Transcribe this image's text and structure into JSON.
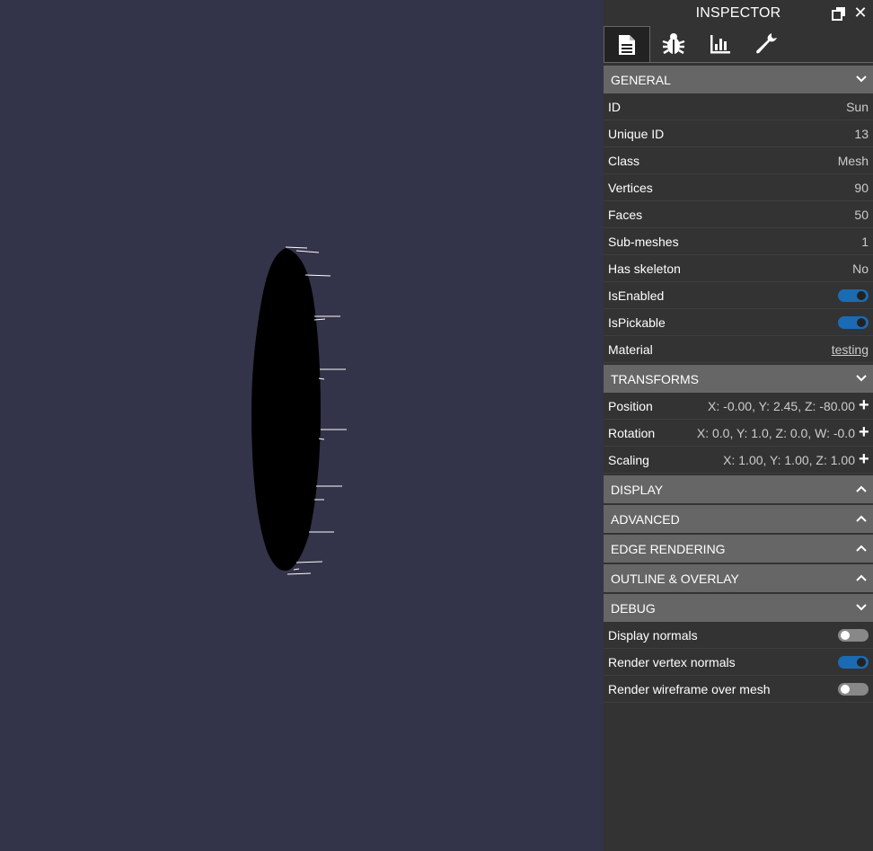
{
  "inspector": {
    "title": "INSPECTOR",
    "tabs": [
      "properties-icon",
      "debug-icon",
      "statistics-icon",
      "tools-icon"
    ],
    "sections": {
      "general": {
        "label": "GENERAL",
        "rows": {
          "id": {
            "label": "ID",
            "value": "Sun"
          },
          "unique_id": {
            "label": "Unique ID",
            "value": "13"
          },
          "class": {
            "label": "Class",
            "value": "Mesh"
          },
          "vertices": {
            "label": "Vertices",
            "value": "90"
          },
          "faces": {
            "label": "Faces",
            "value": "50"
          },
          "submeshes": {
            "label": "Sub-meshes",
            "value": "1"
          },
          "has_skeleton": {
            "label": "Has skeleton",
            "value": "No"
          },
          "is_enabled": {
            "label": "IsEnabled",
            "on": true
          },
          "is_pickable": {
            "label": "IsPickable",
            "on": true
          },
          "material": {
            "label": "Material",
            "value": "testing"
          }
        }
      },
      "transforms": {
        "label": "TRANSFORMS",
        "rows": {
          "position": {
            "label": "Position",
            "value": "X: -0.00, Y: 2.45, Z: -80.00"
          },
          "rotation": {
            "label": "Rotation",
            "value": "X: 0.0, Y: 1.0, Z: 0.0, W: -0.0"
          },
          "scaling": {
            "label": "Scaling",
            "value": "X: 1.00, Y: 1.00, Z: 1.00"
          }
        }
      },
      "display": {
        "label": "DISPLAY"
      },
      "advanced": {
        "label": "ADVANCED"
      },
      "edge_rendering": {
        "label": "EDGE RENDERING"
      },
      "outline_overlay": {
        "label": "OUTLINE & OVERLAY"
      },
      "debug": {
        "label": "DEBUG",
        "rows": {
          "display_normals": {
            "label": "Display normals",
            "on": false
          },
          "render_vertex_normals": {
            "label": "Render vertex normals",
            "on": true
          },
          "render_wireframe": {
            "label": "Render wireframe over mesh",
            "on": false
          }
        }
      }
    }
  },
  "colors": {
    "viewport_bg": "#333349",
    "panel_bg": "#333333",
    "section_header_bg": "#666666",
    "toggle_on": "#1a6bb3",
    "toggle_off": "#888888"
  }
}
